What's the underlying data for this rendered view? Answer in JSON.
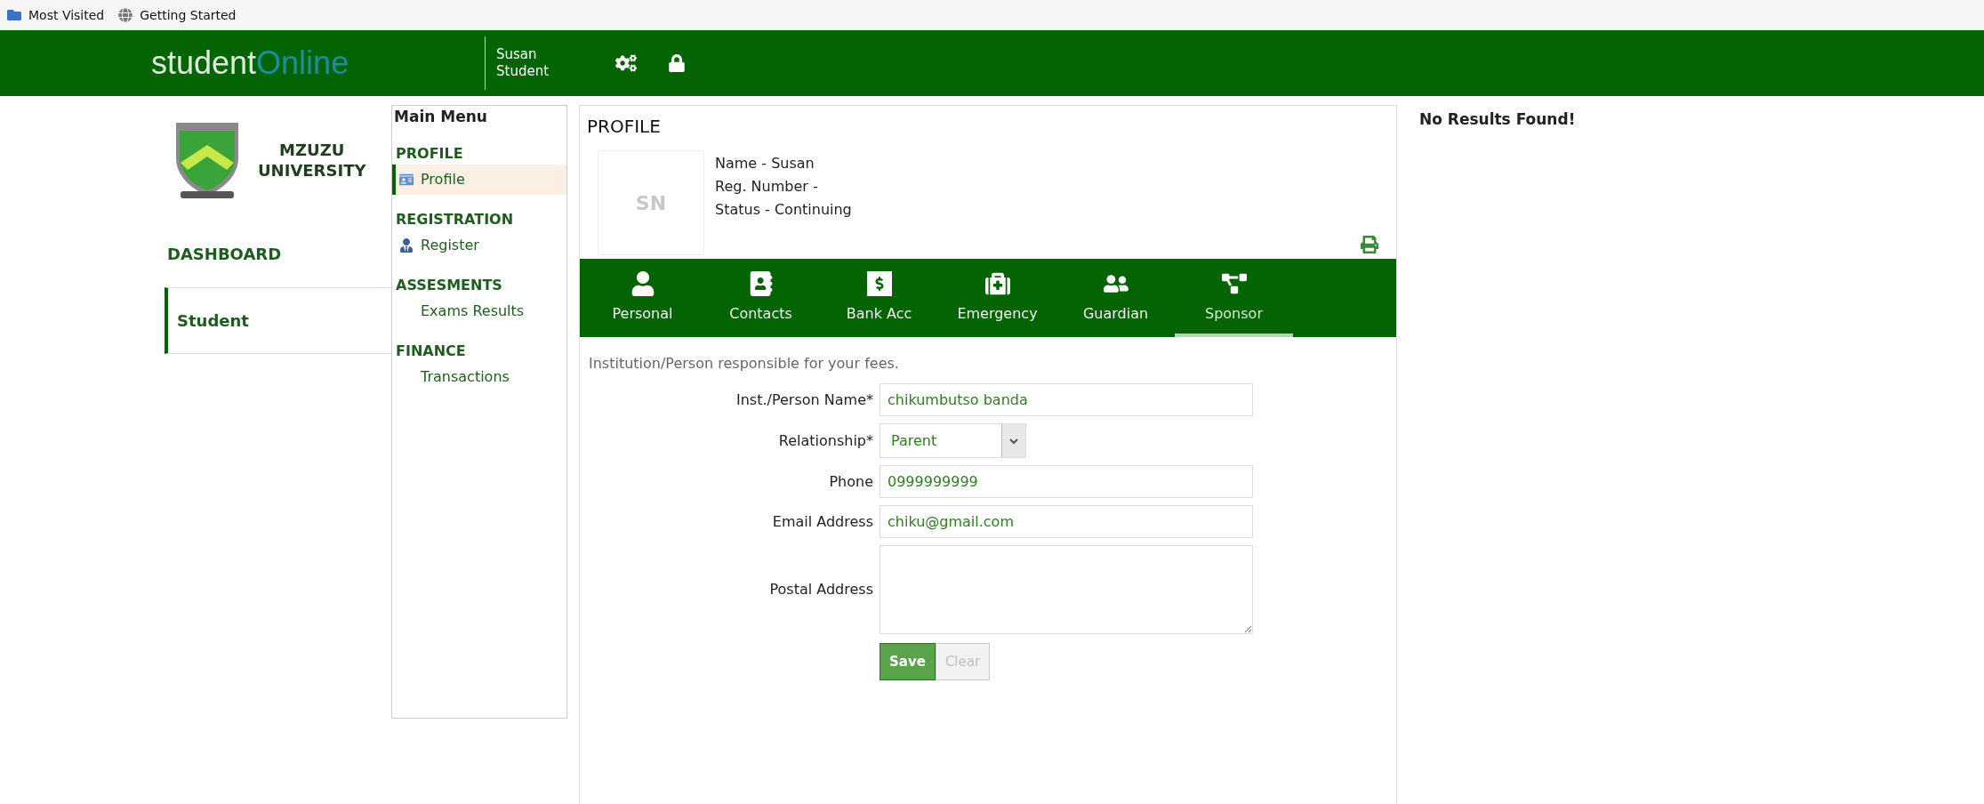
{
  "bookmarks": [
    {
      "label": "Most Visited",
      "kind": "folder"
    },
    {
      "label": "Getting Started",
      "kind": "globe"
    }
  ],
  "header": {
    "logo_main": "student",
    "logo_accent": "Online",
    "user_first": "Susan",
    "user_second": "Student"
  },
  "school": {
    "line_1": "MZUZU",
    "line_2": "UNIVERSITY"
  },
  "left_nav": [
    {
      "label": "DASHBOARD",
      "selected": false
    },
    {
      "label": "Student",
      "selected": true
    }
  ],
  "main_menu": {
    "title": "Main Menu",
    "sections": [
      {
        "heading": "PROFILE",
        "items": [
          {
            "label": "Profile",
            "selected": true
          }
        ]
      },
      {
        "heading": "REGISTRATION",
        "items": [
          {
            "label": "Register",
            "selected": false
          }
        ]
      },
      {
        "heading": "ASSESMENTS",
        "items": [
          {
            "label": "Exams Results",
            "selected": false
          }
        ]
      },
      {
        "heading": "FINANCE",
        "items": [
          {
            "label": "Transactions",
            "selected": false
          }
        ]
      }
    ]
  },
  "profile": {
    "title": "PROFILE",
    "initials": "SN",
    "details": [
      "Name - Susan",
      "Reg. Number -",
      "Status - Continuing"
    ]
  },
  "tabs": [
    {
      "label": "Personal",
      "selected": false
    },
    {
      "label": "Contacts",
      "selected": false
    },
    {
      "label": "Bank Acc",
      "selected": false
    },
    {
      "label": "Emergency",
      "selected": false
    },
    {
      "label": "Guardian",
      "selected": false
    },
    {
      "label": "Sponsor",
      "selected": true
    }
  ],
  "form": {
    "intro": "Institution/Person responsible for your fees.",
    "fields": [
      {
        "label": "Inst./Person Name*",
        "kind": "text",
        "value": "chikumbutso banda"
      },
      {
        "label": "Relationship*",
        "kind": "select",
        "value": "Parent"
      },
      {
        "label": "Phone",
        "kind": "text",
        "value": "0999999999"
      },
      {
        "label": "Email Address",
        "kind": "text",
        "value": "chiku@gmail.com"
      },
      {
        "label": "Postal Address",
        "kind": "textarea"
      }
    ],
    "buttons": [
      {
        "label": "Save",
        "disabled": false
      },
      {
        "label": "Clear",
        "disabled": true
      }
    ]
  },
  "results": {
    "message": "No Results Found!"
  }
}
